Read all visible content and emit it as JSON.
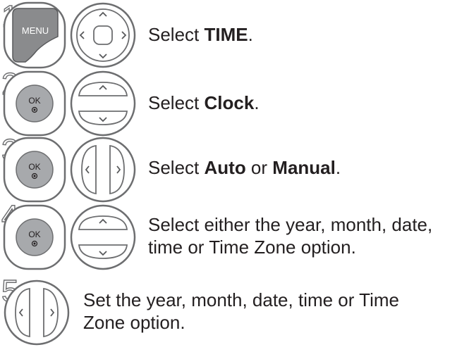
{
  "steps": [
    {
      "number": "1",
      "buttons": [
        "menu-button",
        "navigation-pad"
      ],
      "menu_label": "MENU",
      "pre": "Select ",
      "bold": "TIME",
      "post": "."
    },
    {
      "number": "2",
      "buttons": [
        "ok-button",
        "up-down-rocker"
      ],
      "ok_label": "OK",
      "pre": "Select ",
      "bold": "Clock",
      "post": "."
    },
    {
      "number": "3",
      "buttons": [
        "ok-button",
        "left-right-rocker"
      ],
      "ok_label": "OK",
      "pre": "Select ",
      "bold": "Auto",
      "mid": " or ",
      "bold2": "Manual",
      "post": "."
    },
    {
      "number": "4",
      "buttons": [
        "ok-button",
        "up-down-rocker"
      ],
      "ok_label": "OK",
      "line1": "Select either the year, month, date,",
      "line2": "time or Time Zone option."
    },
    {
      "number": "5",
      "buttons": [
        "left-right-rocker"
      ],
      "line1": "Set the year, month, date, time or Time",
      "line2": "Zone option."
    }
  ]
}
